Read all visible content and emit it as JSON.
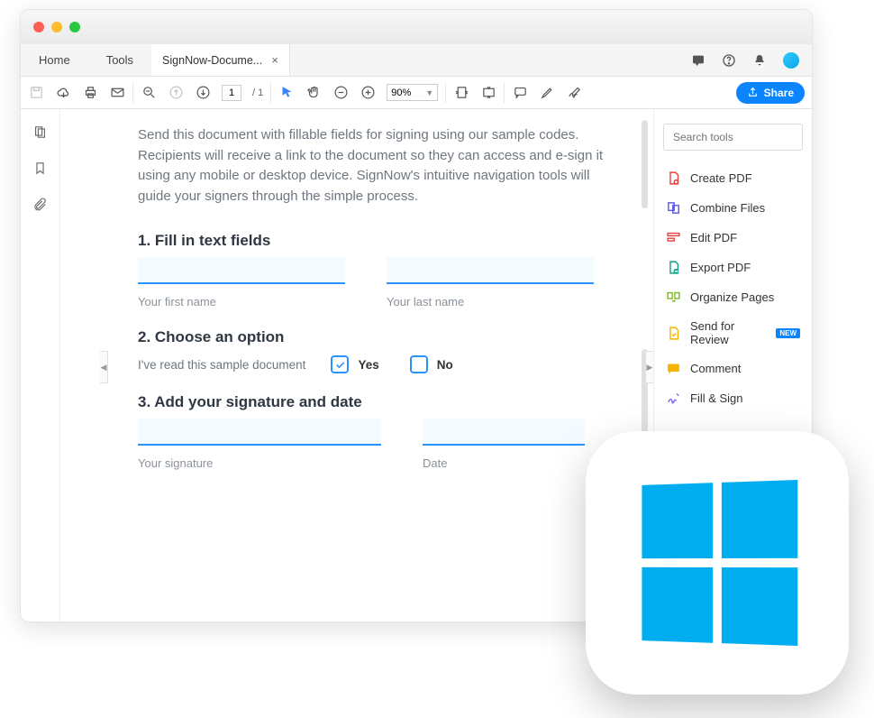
{
  "window": {
    "tabs": {
      "home": "Home",
      "tools": "Tools",
      "active": "SignNow-Docume..."
    }
  },
  "toolbar": {
    "page_current": "1",
    "page_total": "/  1",
    "zoom": "90%",
    "share": "Share"
  },
  "doc": {
    "desc": "Send this document with fillable fields for signing using our sample codes. Recipients will receive a link to the document so they can access and e-sign it using any mobile or desktop device. SignNow's intuitive navigation tools will guide your signers through the simple process.",
    "s1": "1. Fill in text fields",
    "first": "Your first name",
    "last": "Your last name",
    "s2": "2. Choose an option",
    "opt_text": "I've read this sample document",
    "yes": "Yes",
    "no": "No",
    "s3": "3. Add your signature and date",
    "sig": "Your signature",
    "date": "Date"
  },
  "right": {
    "search_ph": "Search tools",
    "items": [
      {
        "label": "Create PDF",
        "color": "#e8413f"
      },
      {
        "label": "Combine Files",
        "color": "#5b5be6"
      },
      {
        "label": "Edit PDF",
        "color": "#e8413f"
      },
      {
        "label": "Export PDF",
        "color": "#14a085"
      },
      {
        "label": "Organize Pages",
        "color": "#7cb926"
      },
      {
        "label": "Send for Review",
        "color": "#f5b400",
        "new": true
      },
      {
        "label": "Comment",
        "color": "#f5b400"
      },
      {
        "label": "Fill & Sign",
        "color": "#7a5cff"
      }
    ]
  }
}
